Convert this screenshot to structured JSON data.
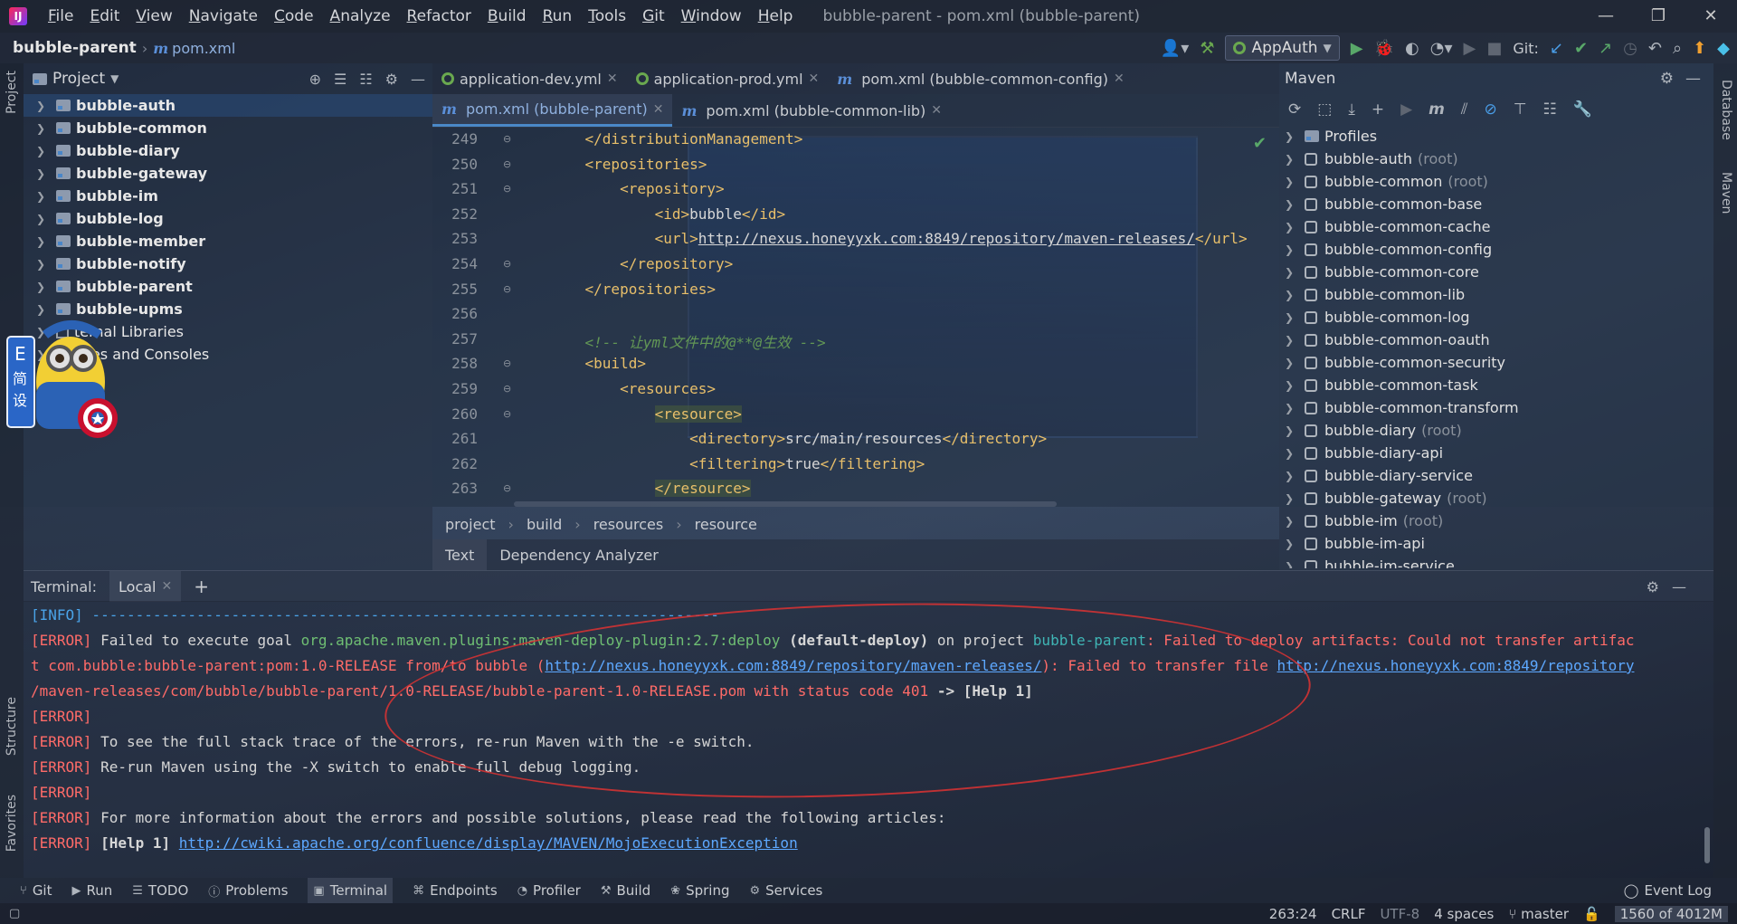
{
  "window": {
    "title": "bubble-parent - pom.xml (bubble-parent)",
    "menu": [
      "File",
      "Edit",
      "View",
      "Navigate",
      "Code",
      "Analyze",
      "Refactor",
      "Build",
      "Run",
      "Tools",
      "Git",
      "Window",
      "Help"
    ],
    "minimize": "—",
    "restore": "❐",
    "close": "✕"
  },
  "navbar": {
    "project": "bubble-parent",
    "file": "pom.xml",
    "run_config": "AppAuth",
    "git_label": "Git:"
  },
  "left_stripe": {
    "project": "Project",
    "structure": "Structure",
    "favorites": "Favorites"
  },
  "right_stripe": {
    "database": "Database",
    "maven": "Maven"
  },
  "project_panel": {
    "title": "Project",
    "items": [
      {
        "label": "bubble-auth",
        "selected": true
      },
      {
        "label": "bubble-common"
      },
      {
        "label": "bubble-diary"
      },
      {
        "label": "bubble-gateway"
      },
      {
        "label": "bubble-im"
      },
      {
        "label": "bubble-log"
      },
      {
        "label": "bubble-member"
      },
      {
        "label": "bubble-notify"
      },
      {
        "label": "bubble-parent"
      },
      {
        "label": "bubble-upms"
      }
    ],
    "external_libraries": "ternal Libraries",
    "scratches": "ches and Consoles"
  },
  "mascot": {
    "badge": "E",
    "chars": [
      "简",
      "设"
    ]
  },
  "editor_tabs_row1": [
    {
      "label": "application-dev.yml",
      "icon": "gear"
    },
    {
      "label": "application-prod.yml",
      "icon": "gear"
    },
    {
      "label": "pom.xml (bubble-common-config)",
      "icon": "m"
    }
  ],
  "editor_tabs_row2": [
    {
      "label": "pom.xml (bubble-parent)",
      "icon": "m",
      "active": true
    },
    {
      "label": "pom.xml (bubble-common-lib)",
      "icon": "m"
    }
  ],
  "editor": {
    "lines": [
      {
        "no": "249",
        "code": "    </distributionManagement>"
      },
      {
        "no": "250",
        "code": "    <repositories>"
      },
      {
        "no": "251",
        "code": "        <repository>"
      },
      {
        "no": "252",
        "code": "            <id>bubble</id>"
      },
      {
        "no": "253",
        "code": "            <url>http://nexus.honeyyxk.com:8849/repository/maven-releases/</url>"
      },
      {
        "no": "254",
        "code": "        </repository>"
      },
      {
        "no": "255",
        "code": "    </repositories>"
      },
      {
        "no": "256",
        "code": ""
      },
      {
        "no": "257",
        "code": "    <!-- 让yml文件中的@**@生效 -->"
      },
      {
        "no": "258",
        "code": "    <build>"
      },
      {
        "no": "259",
        "code": "        <resources>"
      },
      {
        "no": "260",
        "code": "            <resource>"
      },
      {
        "no": "261",
        "code": "                <directory>src/main/resources</directory>"
      },
      {
        "no": "262",
        "code": "                <filtering>true</filtering>"
      },
      {
        "no": "263",
        "code": "            </resource>"
      }
    ],
    "breadcrumb": [
      "project",
      "build",
      "resources",
      "resource"
    ],
    "subtabs": [
      "Text",
      "Dependency Analyzer"
    ]
  },
  "maven": {
    "title": "Maven",
    "items": [
      {
        "label": "Profiles",
        "root": ""
      },
      {
        "label": "bubble-auth",
        "root": "(root)"
      },
      {
        "label": "bubble-common",
        "root": "(root)"
      },
      {
        "label": "bubble-common-base",
        "root": ""
      },
      {
        "label": "bubble-common-cache",
        "root": ""
      },
      {
        "label": "bubble-common-config",
        "root": ""
      },
      {
        "label": "bubble-common-core",
        "root": ""
      },
      {
        "label": "bubble-common-lib",
        "root": ""
      },
      {
        "label": "bubble-common-log",
        "root": ""
      },
      {
        "label": "bubble-common-oauth",
        "root": ""
      },
      {
        "label": "bubble-common-security",
        "root": ""
      },
      {
        "label": "bubble-common-task",
        "root": ""
      },
      {
        "label": "bubble-common-transform",
        "root": ""
      },
      {
        "label": "bubble-diary",
        "root": "(root)"
      },
      {
        "label": "bubble-diary-api",
        "root": ""
      },
      {
        "label": "bubble-diary-service",
        "root": ""
      },
      {
        "label": "bubble-gateway",
        "root": "(root)"
      },
      {
        "label": "bubble-im",
        "root": "(root)"
      },
      {
        "label": "bubble-im-api",
        "root": ""
      },
      {
        "label": "bubble-im-service",
        "root": ""
      }
    ]
  },
  "terminal": {
    "title": "Terminal:",
    "tab": "Local",
    "line_info": "[INFO] ------------------------------------------------------------------------",
    "err_tag": "[ERROR]",
    "l2_a": " Failed to execute goal ",
    "l2_plugin": "org.apache.maven.plugins:maven-deploy-plugin:2.7:deploy",
    "l2_b": " (default-deploy)",
    "l2_c": " on project ",
    "l2_proj": "bubble-parent",
    "l2_d": ": Failed to deploy artifacts: Could not transfer artifac",
    "l3_a": "t com.bubble:bubble-parent:pom:1.0-RELEASE from/to bubble (",
    "l3_link": "http://nexus.honeyyxk.com:8849/repository/maven-releases/",
    "l3_b": "): Failed to transfer file ",
    "l3_link2": "http://nexus.honeyyxk.com:8849/repository",
    "l4_a": "/maven-releases/com/bubble/bubble-parent/1.0-RELEASE/bubble-parent-1.0-RELEASE.pom with status code 401",
    "l4_b": " -> [Help 1]",
    "l6": " To see the full stack trace of the errors, re-run Maven with the -e switch.",
    "l7": " Re-run Maven using the -X switch to enable full debug logging.",
    "l9": " For more information about the errors and possible solutions, please read the following articles:",
    "l10_a": " [Help 1] ",
    "l10_link": "http://cwiki.apache.org/confluence/display/MAVEN/MojoExecutionException"
  },
  "bottom_tools": [
    "Git",
    "Run",
    "TODO",
    "Problems",
    "Terminal",
    "Endpoints",
    "Profiler",
    "Build",
    "Spring",
    "Services"
  ],
  "event_log": "Event Log",
  "status": {
    "position": "263:24",
    "line_sep": "CRLF",
    "encoding": "UTF-8",
    "indent": "4 spaces",
    "branch": "master",
    "memory": "1560 of 4012M"
  }
}
